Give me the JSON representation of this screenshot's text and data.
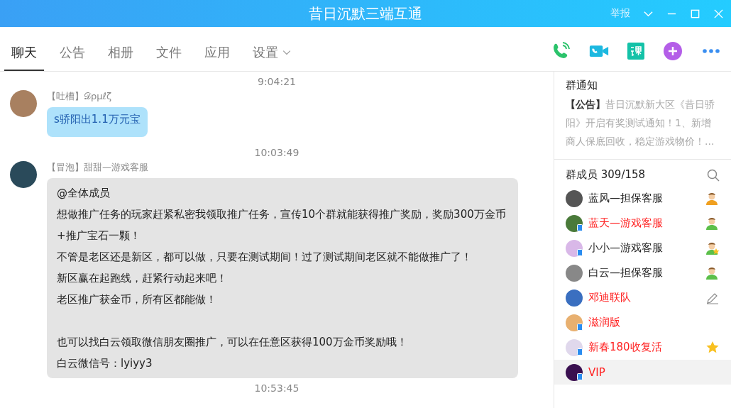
{
  "window": {
    "title": "昔日沉默三端互通",
    "report": "举报"
  },
  "tabs": [
    {
      "label": "聊天",
      "selected": true
    },
    {
      "label": "公告",
      "selected": false
    },
    {
      "label": "相册",
      "selected": false
    },
    {
      "label": "文件",
      "selected": false
    },
    {
      "label": "应用",
      "selected": false
    },
    {
      "label": "设置",
      "selected": false,
      "dropdown": true
    }
  ],
  "chat": [
    {
      "kind": "time",
      "text": "9:04:21"
    },
    {
      "kind": "bubble",
      "tag": "【吐槽】",
      "sender": "𝒟ρμℓζ",
      "paragraphs": [
        [
          "s骄阳出1.1万元宝"
        ]
      ]
    },
    {
      "kind": "time",
      "text": "10:03:49"
    },
    {
      "kind": "card",
      "tag": "【冒泡】",
      "sender": "甜甜—游戏客服",
      "paragraphs": [
        [
          "@全体成员",
          "想做推广任务的玩家赶紧私密我领取推广任务，宣传10个群就能获得推广奖励，奖励300万金币+推广宝石一颗！",
          "不管是老区还是新区，都可以做，只要在测试期间！过了测试期间老区就不能做推广了！",
          "新区赢在起跑线，赶紧行动起来吧！",
          "老区推广获金币，所有区都能做！"
        ],
        [
          "也可以找白云领取微信朋友圈推广，可以在任意区获得100万金币奖励哦！",
          "白云微信号：lyiyy3"
        ]
      ]
    },
    {
      "kind": "time",
      "text": "10:53:45"
    }
  ],
  "notice": {
    "title": "群通知",
    "tag": "【公告】",
    "text": "昔日沉默新大区《昔日骄阳》开启有奖测试通知！1、新增商人保底回收，稳定游戏物价！..."
  },
  "members": {
    "title": "群成员 309/158",
    "items": [
      {
        "name": "蓝风—担保客服",
        "color": "#222222",
        "mobile": false,
        "kind": "owner",
        "selected": false
      },
      {
        "name": "蓝天—游戏客服",
        "color": "#ff2020",
        "mobile": true,
        "kind": "admin",
        "selected": false
      },
      {
        "name": "小小—游戏客服",
        "color": "#222222",
        "mobile": true,
        "kind": "deputy",
        "selected": false
      },
      {
        "name": "白云—担保客服",
        "color": "#222222",
        "mobile": false,
        "kind": "admin",
        "selected": false
      },
      {
        "name": "邓迪联队",
        "color": "#ff2020",
        "mobile": false,
        "kind": "editor",
        "selected": false
      },
      {
        "name": "滋润版",
        "color": "#ff2020",
        "mobile": true,
        "kind": "member",
        "selected": false
      },
      {
        "name": "新春180收复活",
        "color": "#ff2020",
        "mobile": true,
        "kind": "starred",
        "selected": false
      },
      {
        "name": "VIP",
        "color": "#ff2020",
        "mobile": true,
        "kind": "member",
        "selected": true
      }
    ]
  }
}
